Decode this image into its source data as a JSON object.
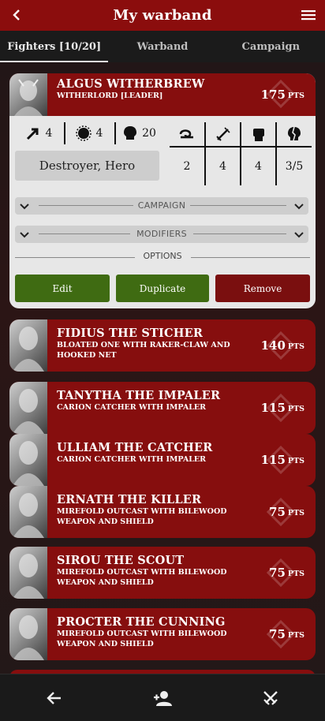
{
  "header": {
    "title": "My warband",
    "back_icon": "chevron-left-icon",
    "menu_icon": "hamburger-menu-icon"
  },
  "tabs": [
    {
      "label": "Fighters [10/20]",
      "active": true
    },
    {
      "label": "Warband",
      "active": false
    },
    {
      "label": "Campaign",
      "active": false
    }
  ],
  "expanded_fighter": {
    "name": "ALGUS WITHERBREW",
    "type": "WITHERLORD [LEADER]",
    "points": "175",
    "points_unit": "PTS",
    "stats": {
      "move": "4",
      "toughness": "4",
      "wounds": "20",
      "range": "2",
      "attacks": "4",
      "strength": "4",
      "damage": "3/5"
    },
    "runemarks": "Destroyer, Hero",
    "sections": {
      "campaign": "CAMPAIGN",
      "modifiers": "MODIFIERS",
      "options": "OPTIONS"
    },
    "buttons": {
      "edit": "Edit",
      "duplicate": "Duplicate",
      "remove": "Remove"
    }
  },
  "fighters": [
    {
      "name": "FIDIUS THE STICHER",
      "type_line1": "BLOATED ONE WITH RAKER-CLAW AND",
      "type_line2": "HOOKED NET",
      "points": "140",
      "unit": "PTS"
    },
    {
      "name": "TANYTHA THE IMPALER",
      "type_line1": "CARION CATCHER WITH IMPALER",
      "type_line2": "",
      "points": "115",
      "unit": "PTS"
    },
    {
      "name": "ULLIAM THE CATCHER",
      "type_line1": "CARION CATCHER WITH IMPALER",
      "type_line2": "",
      "points": "115",
      "unit": "PTS"
    },
    {
      "name": "ERNATH THE KILLER",
      "type_line1": "MIREFOLD OUTCAST WITH BILEWOOD",
      "type_line2": "WEAPON AND SHIELD",
      "points": "75",
      "unit": "PTS"
    },
    {
      "name": "SIROU THE SCOUT",
      "type_line1": "MIREFOLD OUTCAST WITH BILEWOOD",
      "type_line2": "WEAPON AND SHIELD",
      "points": "75",
      "unit": "PTS"
    },
    {
      "name": "PROCTER THE CUNNING",
      "type_line1": "MIREFOLD OUTCAST WITH BILEWOOD",
      "type_line2": "WEAPON AND SHIELD",
      "points": "75",
      "unit": "PTS"
    }
  ],
  "bottom_nav": [
    {
      "icon": "arrow-left-icon"
    },
    {
      "icon": "add-user-icon"
    },
    {
      "icon": "crossed-swords-icon"
    }
  ],
  "colors": {
    "header": "#8b0d0d",
    "card": "#860e0e",
    "edit": "#3f6b12",
    "remove": "#7a0f0f",
    "panel": "#e7e7e7"
  }
}
